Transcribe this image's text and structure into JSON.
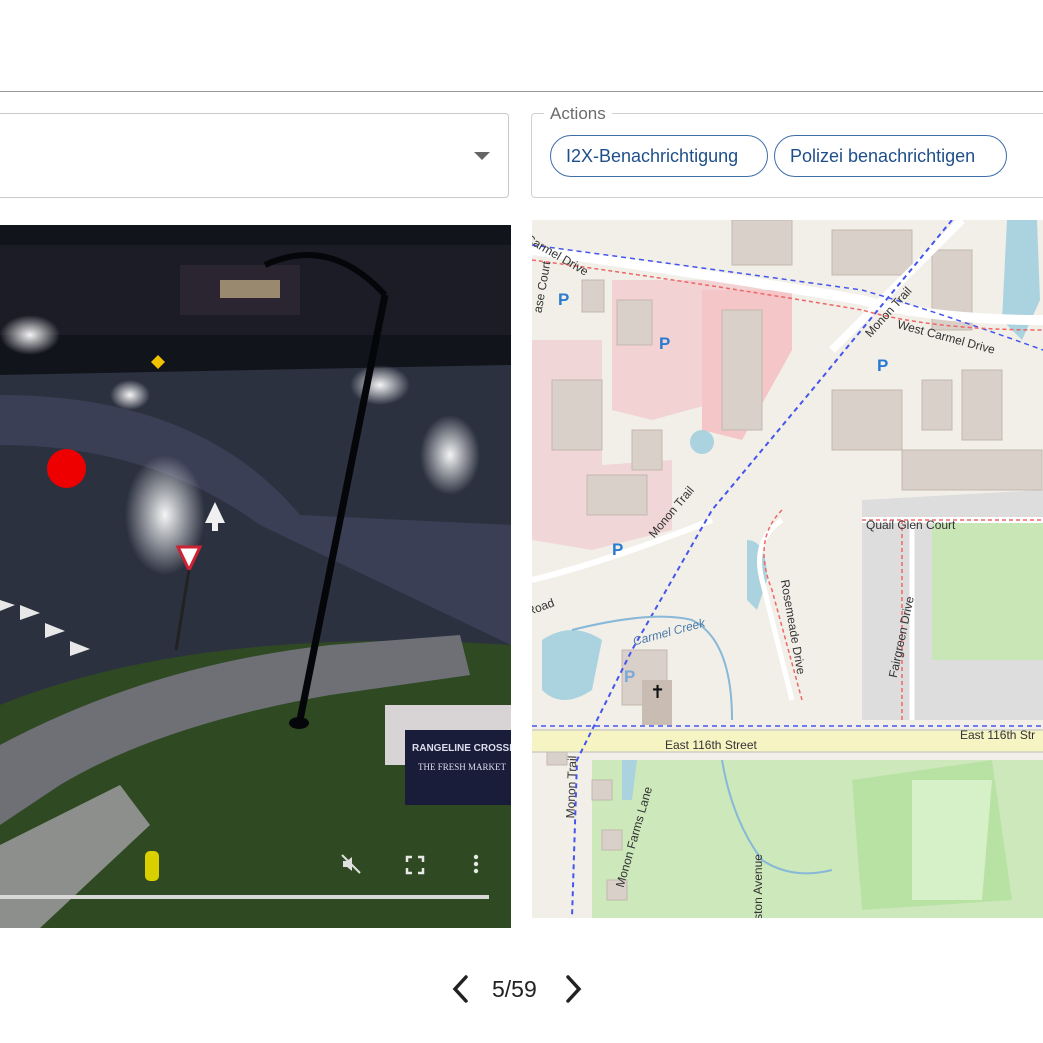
{
  "actions": {
    "legend": "Actions",
    "buttons": [
      {
        "label": "I2X-Benachrichtigung"
      },
      {
        "label": "Polizei benachrichtigen"
      }
    ]
  },
  "camera": {
    "sign_line1": "RANGELINE CROSSING",
    "sign_line2": "THE FRESH MARKET"
  },
  "map": {
    "streets": {
      "carmel_drive": "Carmel Drive",
      "west_carmel_drive": "West Carmel Drive",
      "monon_trail_top": "Monon Trail",
      "monon_trail_mid": "Monon Trail",
      "monon_trail_bottom": "Monon Trail",
      "quail_glen_court": "Quail Glen Court",
      "rosemeade_drive": "Rosemeade Drive",
      "fairgreen_drive": "Fairgreen Drive",
      "carmel_creek": "Carmel Creek",
      "east_116th_left": "East 116th Street",
      "east_116th_right": "East 116th Str",
      "monon_farms_lane": "Monon Farms Lane",
      "road_left": "Road",
      "court_left": "ase Court",
      "avenue": "ston Avenue"
    },
    "parking_symbol": "P"
  },
  "pager": {
    "current": 5,
    "total": 59,
    "text": "5/59"
  },
  "colors": {
    "chip_border": "#3d6ea8",
    "chip_text": "#1f4f8a",
    "marker": "#ee0000"
  }
}
